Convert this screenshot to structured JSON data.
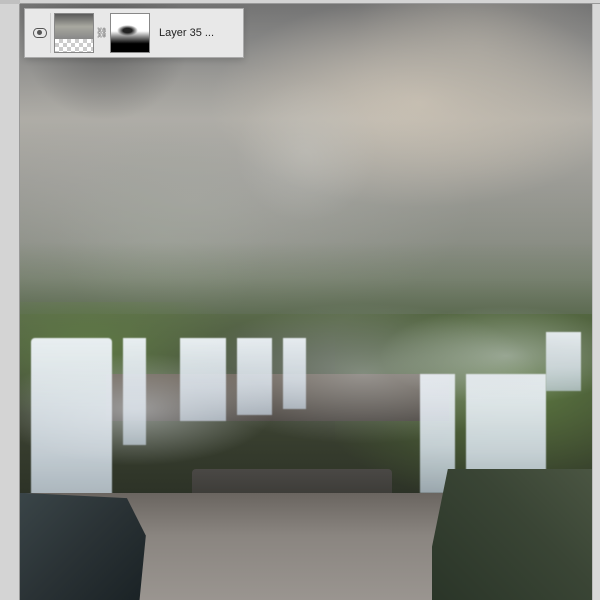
{
  "layer_panel": {
    "visibility_icon": "eye-icon",
    "link_icon": "link-icon",
    "layer_name": "Layer 35 ..."
  }
}
